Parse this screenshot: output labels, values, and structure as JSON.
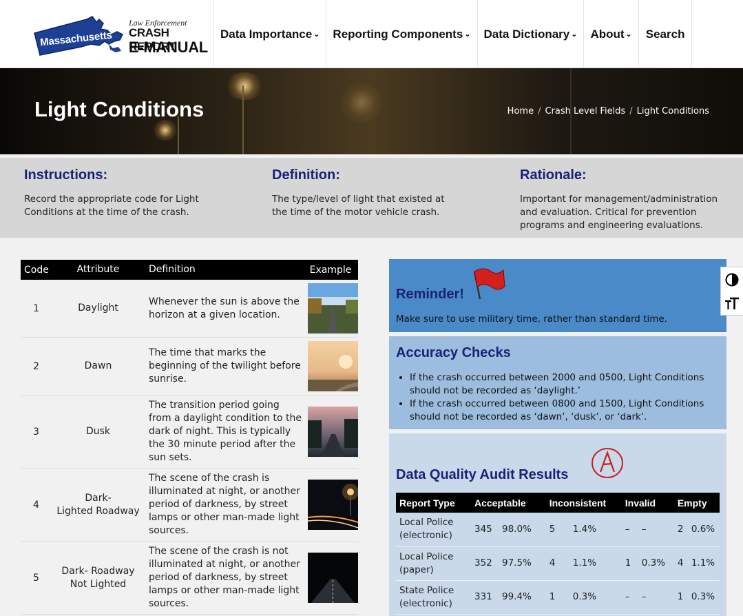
{
  "logo": {
    "state": "Massachusetts",
    "line1": "Law Enforcement",
    "line2": "CRASH REPORT",
    "line3": "E-MANUAL"
  },
  "nav": [
    {
      "label": "Data Importance",
      "chevron": true
    },
    {
      "label": "Reporting Components",
      "chevron": true
    },
    {
      "label": "Data Dictionary",
      "chevron": true
    },
    {
      "label": "About",
      "chevron": true
    },
    {
      "label": "Search",
      "chevron": false
    }
  ],
  "hero": {
    "title": "Light Conditions",
    "breadcrumb": [
      "Home",
      "Crash Level Fields",
      "Light Conditions"
    ]
  },
  "info": {
    "instructions": {
      "title": "Instructions:",
      "text": "Record the appropriate code for Light Conditions at the time of the crash."
    },
    "definition": {
      "title": "Definition:",
      "text": "The type/level of light that existed at the time of the motor vehicle crash."
    },
    "rationale": {
      "title": "Rationale:",
      "text": "Important for management/administration and evaluation. Critical for prevention programs and engineering evaluations."
    }
  },
  "codes": {
    "headers": {
      "code": "Code",
      "attribute": "Attribute",
      "definition": "Definition",
      "example": "Example"
    },
    "rows": [
      {
        "code": "1",
        "attribute": "Daylight",
        "definition": "Whenever the sun is above the horizon at a given location."
      },
      {
        "code": "2",
        "attribute": "Dawn",
        "definition": "The time that marks the beginning of the twilight before sunrise."
      },
      {
        "code": "3",
        "attribute": "Dusk",
        "definition": "The transition period going from a daylight condition to the dark of night. This is typically the 30 minute period after the sun sets."
      },
      {
        "code": "4",
        "attribute": "Dark-\nLighted Roadway",
        "definition": "The scene of the crash is illuminated at night, or another period of darkness, by street lamps or other man-made light sources."
      },
      {
        "code": "5",
        "attribute": "Dark- Roadway Not Lighted",
        "definition": "The scene of the crash is not illuminated at night, or another period of darkness, by street lamps or other man-made light sources."
      }
    ]
  },
  "reminder": {
    "title": "Reminder!",
    "text": "Make sure to use military time, rather than standard time."
  },
  "accuracy": {
    "title": "Accuracy Checks",
    "items": [
      "If the crash occurred between 2000 and 0500, Light Conditions should not be recorded as ‘daylight.’",
      "If the crash occurred between 0800 and 1500, Light Conditions should not be recorded as ‘dawn’, ‘dusk’, or ‘dark’."
    ]
  },
  "audit": {
    "title": "Data Quality Audit Results",
    "headers": [
      "Report Type",
      "Acceptable",
      "",
      "Inconsistent",
      "",
      "Invalid",
      "",
      "Empty",
      ""
    ],
    "rows": [
      [
        "Local Police (electronic)",
        "345",
        "98.0%",
        "5",
        "1.4%",
        "–",
        "–",
        "2",
        "0.6%"
      ],
      [
        "Local Police (paper)",
        "352",
        "97.5%",
        "4",
        "1.1%",
        "1",
        "0.3%",
        "4",
        "1.1%"
      ],
      [
        "State Police (electronic)",
        "331",
        "99.4%",
        "1",
        "0.3%",
        "–",
        "–",
        "1",
        "0.3%"
      ]
    ]
  },
  "colors": {
    "heading": "#1a2178",
    "reminder_bg": "#4a8ac9",
    "accuracy_bg": "#9cbddd",
    "audit_bg": "#c9d9ea",
    "band_bg": "#d6d6d6"
  }
}
